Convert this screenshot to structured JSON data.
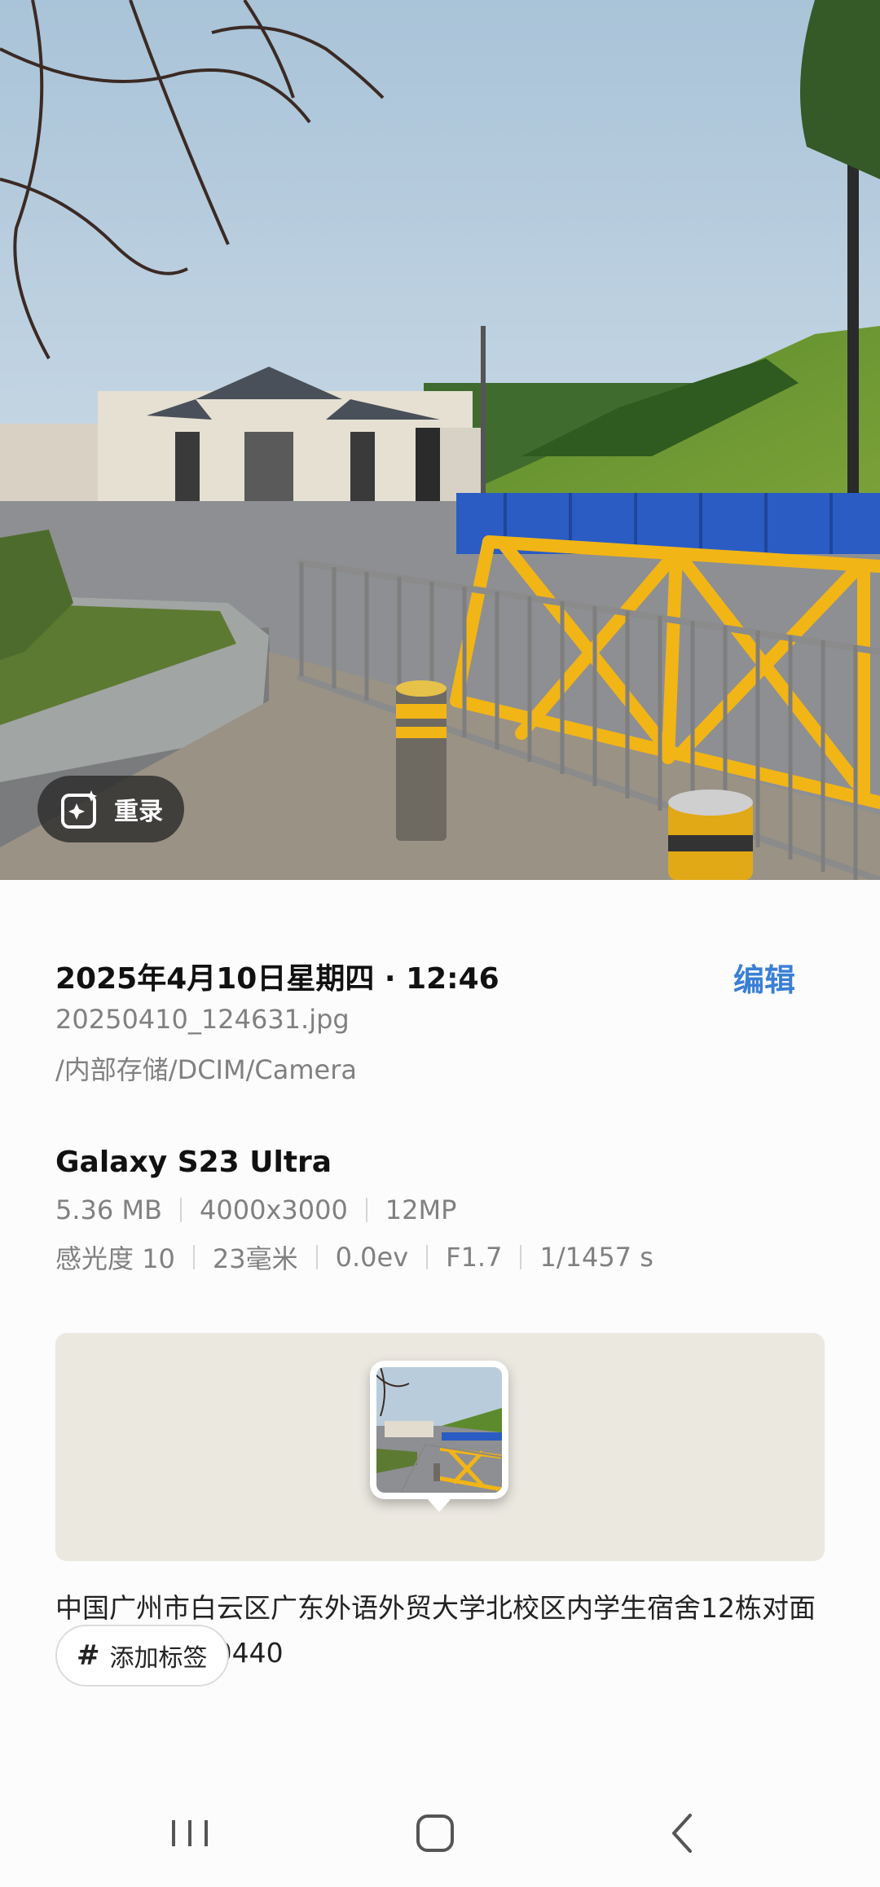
{
  "photo": {
    "remaster_label": "重录"
  },
  "details": {
    "datetime": "2025年4月10日星期四 · 12:46",
    "edit_label": "编辑",
    "filename": "20250410_124631.jpg",
    "path": "/内部存储/DCIM/Camera",
    "device": "Galaxy S23 Ultra",
    "file_specs": [
      "5.36 MB",
      "4000x3000",
      "12MP"
    ],
    "camera_specs": [
      "感光度 10",
      "23毫米",
      "0.0ev",
      "F1.7",
      "1/1457 s"
    ],
    "address": "中国广州市白云区广东外语外贸大学北校区内学生宿舍12栋对面 邮政编码: 510440",
    "tag_label": "添加标签"
  },
  "navbar": {
    "recent_icon": "recent-apps-icon",
    "home_icon": "home-icon",
    "back_icon": "back-icon"
  },
  "colors": {
    "accent": "#3a7fd5",
    "secondary_text": "#808080",
    "map_background": "#ebe8e0"
  }
}
